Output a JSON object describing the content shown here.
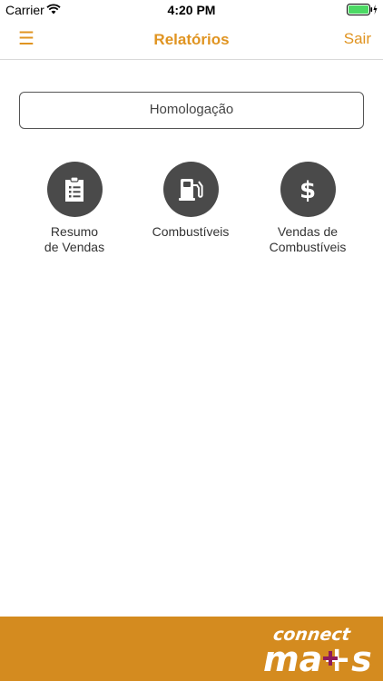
{
  "status_bar": {
    "carrier": "Carrier",
    "time": "4:20 PM",
    "wifi_icon": "wifi-icon",
    "battery_icon": "battery-charging-icon",
    "battery_color": "#4cd964"
  },
  "nav": {
    "menu_icon": "☰",
    "title": "Relatórios",
    "logout_label": "Sair",
    "accent_color": "#e09421"
  },
  "environment": {
    "selected": "Homologação"
  },
  "reports": [
    {
      "label": "Resumo\nde Vendas",
      "icon": "clipboard-list-icon"
    },
    {
      "label": "Combustíveis",
      "icon": "fuel-pump-icon"
    },
    {
      "label": "Vendas de\nCombustíveis",
      "icon": "dollar-icon"
    }
  ],
  "footer": {
    "brand_line1": "connect",
    "brand_line2": "ma+s",
    "background_color": "#d48b1f",
    "plus_color": "#8e1b5b"
  }
}
